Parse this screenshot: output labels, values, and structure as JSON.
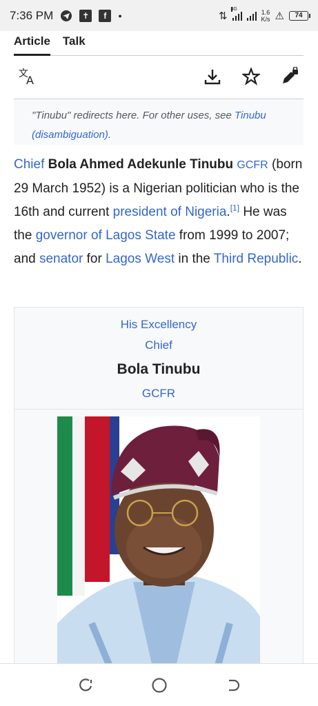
{
  "status_bar": {
    "time": "7:36 PM",
    "icons": [
      "telegram-icon",
      "bible-app-icon",
      "facebook-icon",
      "notification-dot"
    ],
    "network_generation": "4G",
    "net_speed_value": "1.6",
    "net_speed_unit": "K/s",
    "battery_level": "74"
  },
  "tabs": [
    {
      "label": "Article",
      "active": true
    },
    {
      "label": "Talk",
      "active": false
    }
  ],
  "toolbar": {
    "icons": [
      "translate-icon",
      "download-icon",
      "star-icon",
      "edit-locked-icon"
    ]
  },
  "hatnote": {
    "prefix": "\"Tinubu\" redirects here. For other uses, see ",
    "link": "Tinubu (disambiguation)",
    "suffix": "."
  },
  "lead": {
    "chief_link": "Chief",
    "name_bold": "Bola Ahmed Adekunle Tinubu",
    "gcfr_link": "GCFR",
    "text1": "(born 29 March 1952) is a Nigerian politician who is the 16th and current",
    "president_link": "president of Nigeria",
    "period1": ".",
    "ref": "[1]",
    "text2": "He was the",
    "governor_link": "governor of Lagos State",
    "text3": "from 1999 to 2007; and",
    "senator_link": "senator",
    "text4": "for",
    "lagos_west_link": "Lagos West",
    "text5": "in the",
    "third_republic_link": "Third Republic",
    "period2": "."
  },
  "infobox": {
    "honorific1": "His Excellency",
    "honorific2": "Chief",
    "name": "Bola Tinubu",
    "post_nominal": "GCFR"
  },
  "nav_bar": {
    "icons": [
      "recent-apps-icon",
      "home-icon",
      "back-icon"
    ]
  }
}
